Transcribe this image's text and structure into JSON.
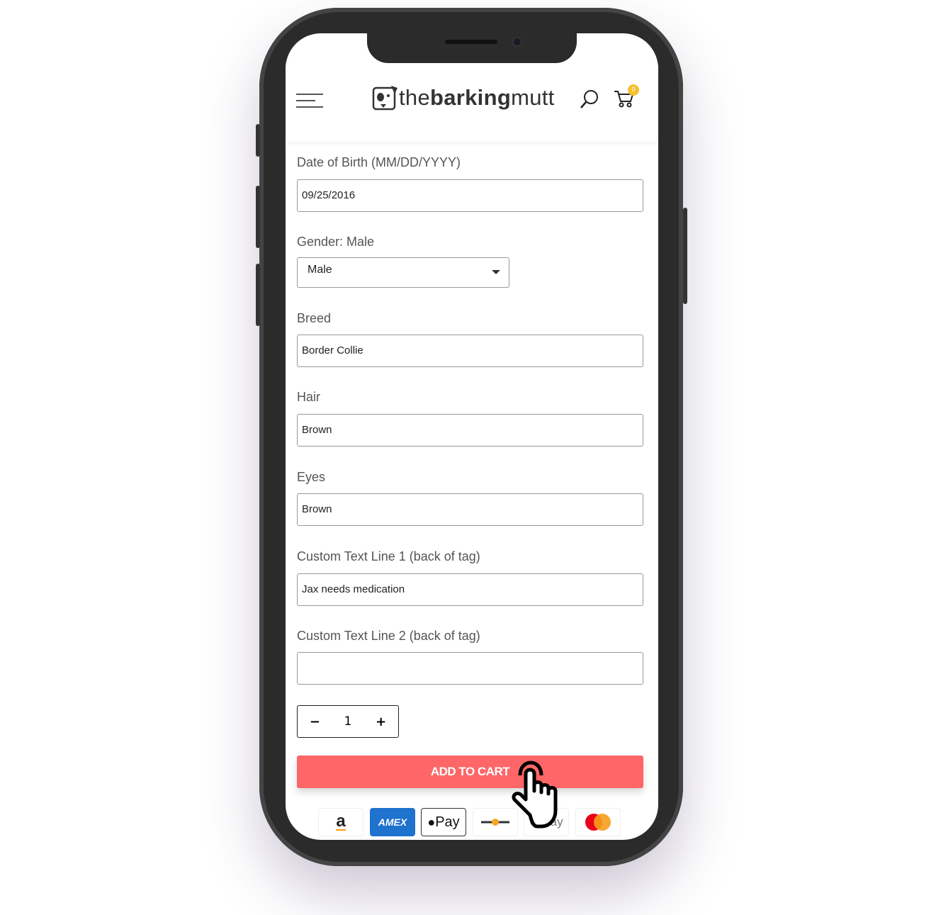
{
  "header": {
    "logo_text_light": "the",
    "logo_text_bold": "barking",
    "logo_text_end": "mutt",
    "cart_count": "0"
  },
  "form": {
    "dob": {
      "label": "Date of Birth (MM/DD/YYYY)",
      "value": "09/25/2016"
    },
    "gender": {
      "label": "Gender:  Male",
      "value": "Male"
    },
    "breed": {
      "label": "Breed",
      "value": "Border Collie"
    },
    "hair": {
      "label": "Hair",
      "value": "Brown"
    },
    "eyes": {
      "label": "Eyes",
      "value": "Brown"
    },
    "custom1": {
      "label": "Custom Text Line 1 (back of tag)",
      "value": "Jax needs medication"
    },
    "custom2": {
      "label": "Custom Text Line 2 (back of tag)",
      "value": ""
    },
    "quantity": {
      "minus": "−",
      "value": "1",
      "plus": "+"
    },
    "add_to_cart": "ADD TO CART"
  },
  "payments": {
    "amazon": "a",
    "amex": "AMEX",
    "applepay": "Pay",
    "gpay": "G Pay"
  },
  "colors": {
    "accent": "#fe6667",
    "badge": "#f5c02c",
    "amex": "#1f72cd"
  }
}
